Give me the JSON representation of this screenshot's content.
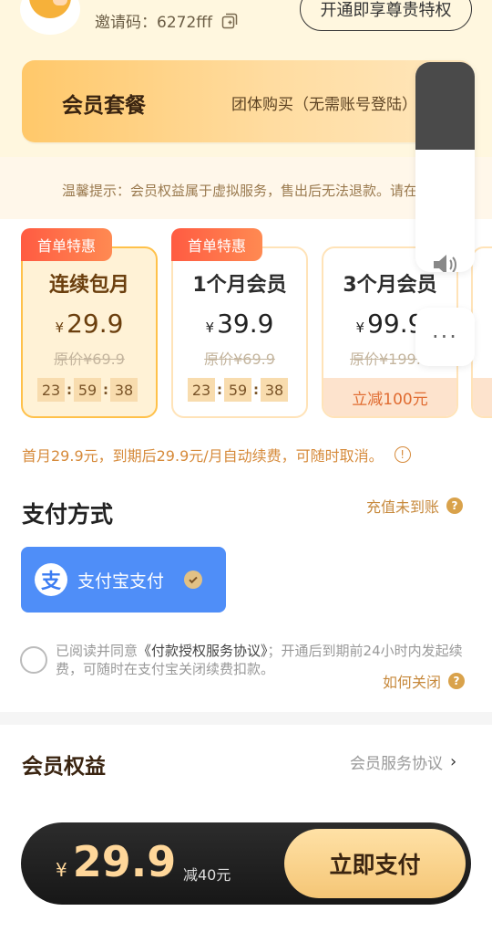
{
  "header": {
    "invite_code": "邀请码：6272fff",
    "vip_button": "开通即享尊贵特权"
  },
  "package": {
    "title": "会员套餐",
    "group_buy": "团体购买（无需账号登陆）",
    "chevron": "›"
  },
  "notice": {
    "text": "温馨提示：会员权益属于虚拟服务，售出后无法退款。请在"
  },
  "plans": [
    {
      "badge": "首单特惠",
      "name": "连续包月",
      "yen": "¥",
      "price": "29.9",
      "original": "原价¥69.9",
      "timer": [
        "23",
        "59",
        "38"
      ],
      "selected": true
    },
    {
      "badge": "首单特惠",
      "name": "1个月会员",
      "yen": "¥",
      "price": "39.9",
      "original": "原价¥69.9",
      "timer": [
        "23",
        "59",
        "38"
      ],
      "selected": false
    },
    {
      "name": "3个月会员",
      "yen": "¥",
      "price": "99.9",
      "original": "原价¥199.9",
      "discount": "立减100元",
      "selected": false
    }
  ],
  "renew_note": "首月29.9元，到期后29.9元/月自动续费，可随时取消。",
  "payment": {
    "title": "支付方式",
    "recharge_link": "充值未到账",
    "alipay_logo": "支",
    "alipay_label": "支付宝支付"
  },
  "agreement": {
    "prefix": "已阅读并同意",
    "link": "《付款授权服务协议》",
    "suffix": "；开通后到期前24小时内发起续费，可随时在支付宝关闭续费扣款。",
    "how_close": "如何关闭"
  },
  "benefits": {
    "title": "会员权益",
    "agreement_link": "会员服务协议",
    "chevron": "›"
  },
  "paybar": {
    "yen": "¥",
    "price": "29.9",
    "off": "减40元",
    "pay_now": "立即支付"
  },
  "float": {
    "more": "···"
  },
  "icons": {
    "info": "!",
    "question": "?",
    "colon": ":"
  },
  "colors": {
    "accent": "#ffc14a",
    "alipay": "#4f8ef8",
    "badge": "#ff5b42",
    "discount_text": "#e06b30",
    "link": "#c7893c"
  }
}
